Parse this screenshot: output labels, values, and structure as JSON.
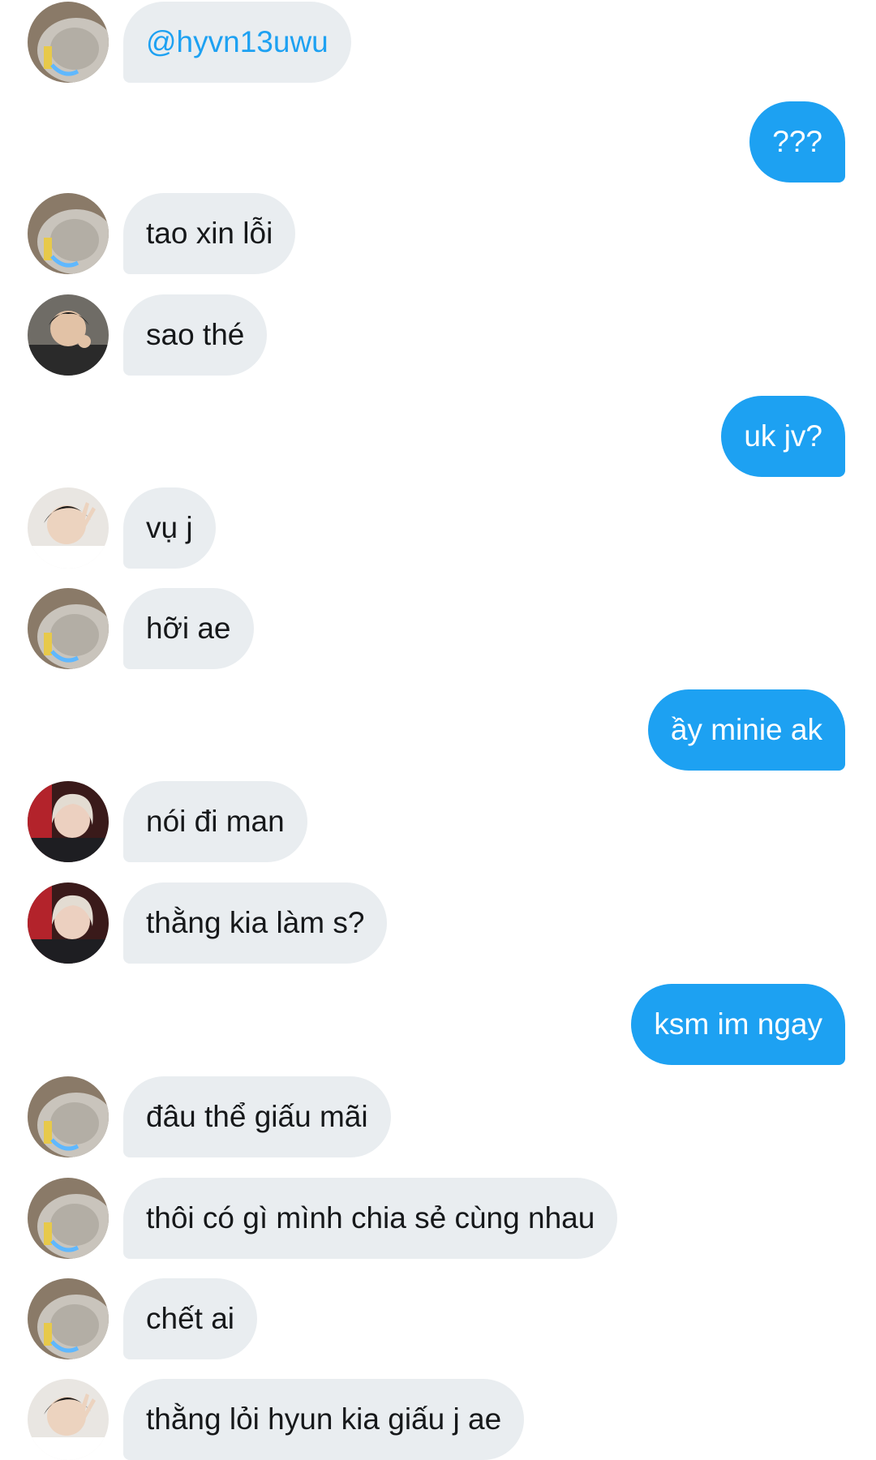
{
  "conversation": {
    "messages": [
      {
        "direction": "in",
        "sender": "avatar-cat",
        "text": "@hyvn13uwu",
        "mention": true
      },
      {
        "direction": "out",
        "text": "???"
      },
      {
        "direction": "in",
        "sender": "avatar-cat",
        "text": "tao xin lỗi"
      },
      {
        "direction": "in",
        "sender": "avatar-boy-dark",
        "text": "sao thé"
      },
      {
        "direction": "out",
        "text": "uk jv?"
      },
      {
        "direction": "in",
        "sender": "avatar-boy-peace",
        "text": "vụ j"
      },
      {
        "direction": "in",
        "sender": "avatar-cat",
        "text": "hỡi ae"
      },
      {
        "direction": "out",
        "text": "ầy minie ak"
      },
      {
        "direction": "in",
        "sender": "avatar-blonde",
        "text": "nói đi man"
      },
      {
        "direction": "in",
        "sender": "avatar-blonde",
        "text": "thằng kia làm s?"
      },
      {
        "direction": "out",
        "text": "ksm im ngay"
      },
      {
        "direction": "in",
        "sender": "avatar-cat",
        "text": "đâu thể giấu mãi"
      },
      {
        "direction": "in",
        "sender": "avatar-cat",
        "text": "thôi có gì mình chia sẻ cùng nhau"
      },
      {
        "direction": "in",
        "sender": "avatar-cat",
        "text": "chết ai"
      },
      {
        "direction": "in",
        "sender": "avatar-boy-peace",
        "text": "thằng lỏi hyun kia giấu j ae"
      }
    ]
  },
  "colors": {
    "outgoing_bubble": "#1da1f2",
    "incoming_bubble": "#e9edf0",
    "mention_text": "#1da1f2"
  }
}
